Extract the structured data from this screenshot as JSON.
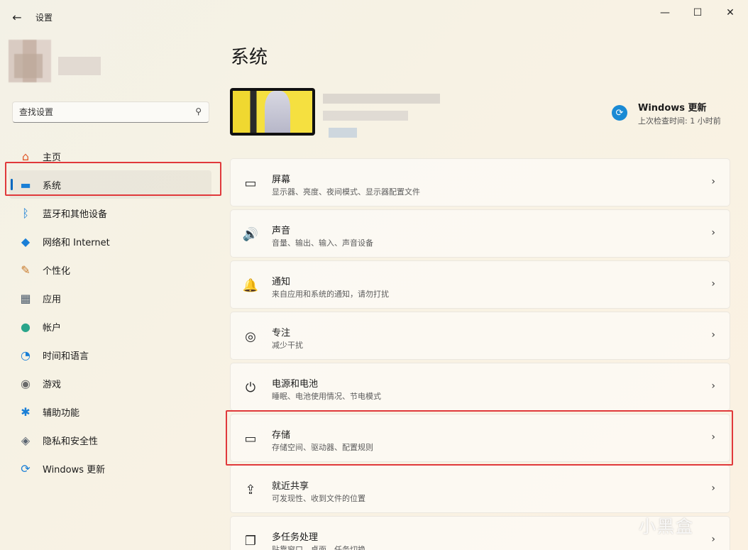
{
  "window": {
    "title": "设置",
    "back_icon": "arrow-left-icon",
    "minimize_glyph": "—",
    "maximize_glyph": "☐",
    "close_glyph": "✕"
  },
  "search": {
    "placeholder": "查找设置",
    "icon": "search-icon"
  },
  "sidebar": {
    "items": [
      {
        "label": "主页",
        "icon": "home-icon",
        "glyph": "⌂",
        "color": "#e05a2b"
      },
      {
        "label": "系统",
        "icon": "system-icon",
        "glyph": "▬",
        "color": "#1a7fd6",
        "active": true
      },
      {
        "label": "蓝牙和其他设备",
        "icon": "bluetooth-icon",
        "glyph": "ᛒ",
        "color": "#1a7fd6"
      },
      {
        "label": "网络和 Internet",
        "icon": "wifi-icon",
        "glyph": "◆",
        "color": "#1a7fd6"
      },
      {
        "label": "个性化",
        "icon": "brush-icon",
        "glyph": "✎",
        "color": "#c87a2a"
      },
      {
        "label": "应用",
        "icon": "apps-icon",
        "glyph": "▦",
        "color": "#4a5a6a"
      },
      {
        "label": "帐户",
        "icon": "account-icon",
        "glyph": "●",
        "color": "#2aa58a"
      },
      {
        "label": "时间和语言",
        "icon": "clock-globe-icon",
        "glyph": "◔",
        "color": "#1a7fd6"
      },
      {
        "label": "游戏",
        "icon": "gamepad-icon",
        "glyph": "◉",
        "color": "#6a6a6a"
      },
      {
        "label": "辅助功能",
        "icon": "accessibility-icon",
        "glyph": "✱",
        "color": "#1a7fd6"
      },
      {
        "label": "隐私和安全性",
        "icon": "shield-icon",
        "glyph": "◈",
        "color": "#5a6470"
      },
      {
        "label": "Windows 更新",
        "icon": "windows-update-icon",
        "glyph": "⟳",
        "color": "#1a7fd6"
      }
    ]
  },
  "main": {
    "title": "系统",
    "update": {
      "title": "Windows 更新",
      "subtitle": "上次检查时间: 1 小时前",
      "glyph": "⟳"
    },
    "cards": [
      {
        "title": "屏幕",
        "subtitle": "显示器、亮度、夜间模式、显示器配置文件",
        "icon": "display-icon",
        "glyph": "▭"
      },
      {
        "title": "声音",
        "subtitle": "音量、输出、输入、声音设备",
        "icon": "speaker-icon",
        "glyph": "🔊"
      },
      {
        "title": "通知",
        "subtitle": "来自应用和系统的通知，请勿打扰",
        "icon": "bell-icon",
        "glyph": "🔔"
      },
      {
        "title": "专注",
        "subtitle": "减少干扰",
        "icon": "focus-icon",
        "glyph": "◎"
      },
      {
        "title": "电源和电池",
        "subtitle": "睡眠、电池使用情况、节电模式",
        "icon": "power-icon",
        "glyph": "⏻"
      },
      {
        "title": "存储",
        "subtitle": "存储空间、驱动器、配置规则",
        "icon": "storage-icon",
        "glyph": "▭"
      },
      {
        "title": "就近共享",
        "subtitle": "可发现性、收到文件的位置",
        "icon": "share-icon",
        "glyph": "⇪"
      },
      {
        "title": "多任务处理",
        "subtitle": "贴靠窗口、桌面、任务切换",
        "icon": "multitask-icon",
        "glyph": "❐"
      }
    ],
    "chevron": "›"
  },
  "watermark": "小黑盒"
}
